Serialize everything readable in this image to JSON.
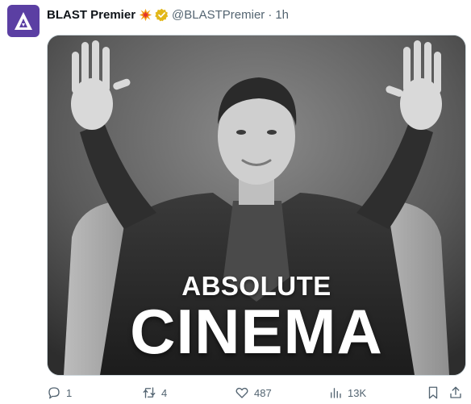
{
  "author": {
    "display_name": "BLAST Premier",
    "handle": "@BLASTPremier",
    "separator": "·",
    "timestamp": "1h",
    "avatar_icon": "blast-logo-icon",
    "emoji_icon": "collision-emoji-icon",
    "verified_icon": "verified-badge-icon"
  },
  "media": {
    "caption_top": "ABSOLUTE",
    "caption_main": "CINEMA"
  },
  "actions": {
    "reply_count": "1",
    "retweet_count": "4",
    "like_count": "487",
    "views_count": "13K"
  },
  "colors": {
    "avatar_bg": "#5b3fa3",
    "verified_gold": "#e2b719",
    "muted_text": "#536471"
  }
}
